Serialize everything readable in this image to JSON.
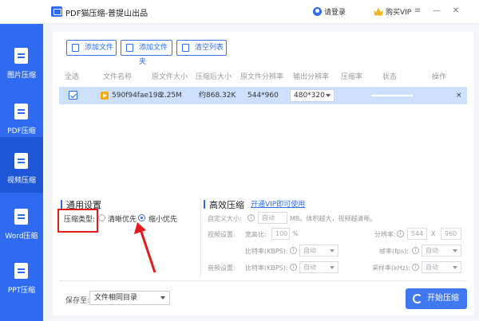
{
  "app": {
    "title": "PDF猫压缩-普提山出品",
    "login": "请登录",
    "vip": "购买VIP"
  },
  "colors": {
    "brand": "#2f6bf0",
    "highlight": "#e21b1b"
  },
  "sidebar": {
    "items": [
      {
        "label": "图片压缩",
        "icon": "image-file-icon"
      },
      {
        "label": "PDF压缩",
        "icon": "pdf-file-icon"
      },
      {
        "label": "视频压缩",
        "icon": "video-file-icon",
        "active": true
      },
      {
        "label": "Word压缩",
        "icon": "word-file-icon"
      },
      {
        "label": "PPT压缩",
        "icon": "ppt-file-icon"
      }
    ]
  },
  "toolbar": {
    "add_file": "添加文件",
    "add_folder": "添加文件夹",
    "clear_list": "清空列表"
  },
  "table": {
    "headers": [
      "全选",
      "文件名称",
      "原文件大小",
      "压缩后大小",
      "原文件分辨率",
      "输出分辨率",
      "压缩率",
      "状态",
      "操作"
    ],
    "rows": [
      {
        "name": "590f94fae198...",
        "orig_size": "2.25M",
        "compressed_size": "约868.32K",
        "orig_res": "544*960",
        "out_res": "480*320",
        "row_action": "×"
      }
    ]
  },
  "general": {
    "title": "通用设置",
    "type_label": "压缩类型:",
    "options": [
      "清晰优先",
      "缩小优先"
    ],
    "selected": "缩小优先"
  },
  "advanced": {
    "title": "高效压缩",
    "vip_link": "开通VIP即可使用",
    "custom_size_label": "自定义大小:",
    "custom_size_value": "自动",
    "custom_size_hint": "MB。体积越大，视频越清晰。",
    "video_settings": "视频设置:",
    "aspect_label": "宽高比:",
    "aspect_value": "100",
    "aspect_unit": "%",
    "res_label": "分辨率:",
    "res_w": "544",
    "res_x": "X",
    "res_h": "960",
    "bitrate_label": "比特率(KBPS):",
    "bitrate_value": "自动",
    "fps_label": "帧率(fps):",
    "fps_value": "自动",
    "audio_settings": "音频设置:",
    "audio_bitrate_label": "比特率(KBPS):",
    "audio_bitrate_value": "自动",
    "sample_label": "采样率(kHz):",
    "sample_value": "自动"
  },
  "footer": {
    "save_label": "保存至:",
    "save_value": "文件相同目录",
    "start": "开始压缩"
  }
}
